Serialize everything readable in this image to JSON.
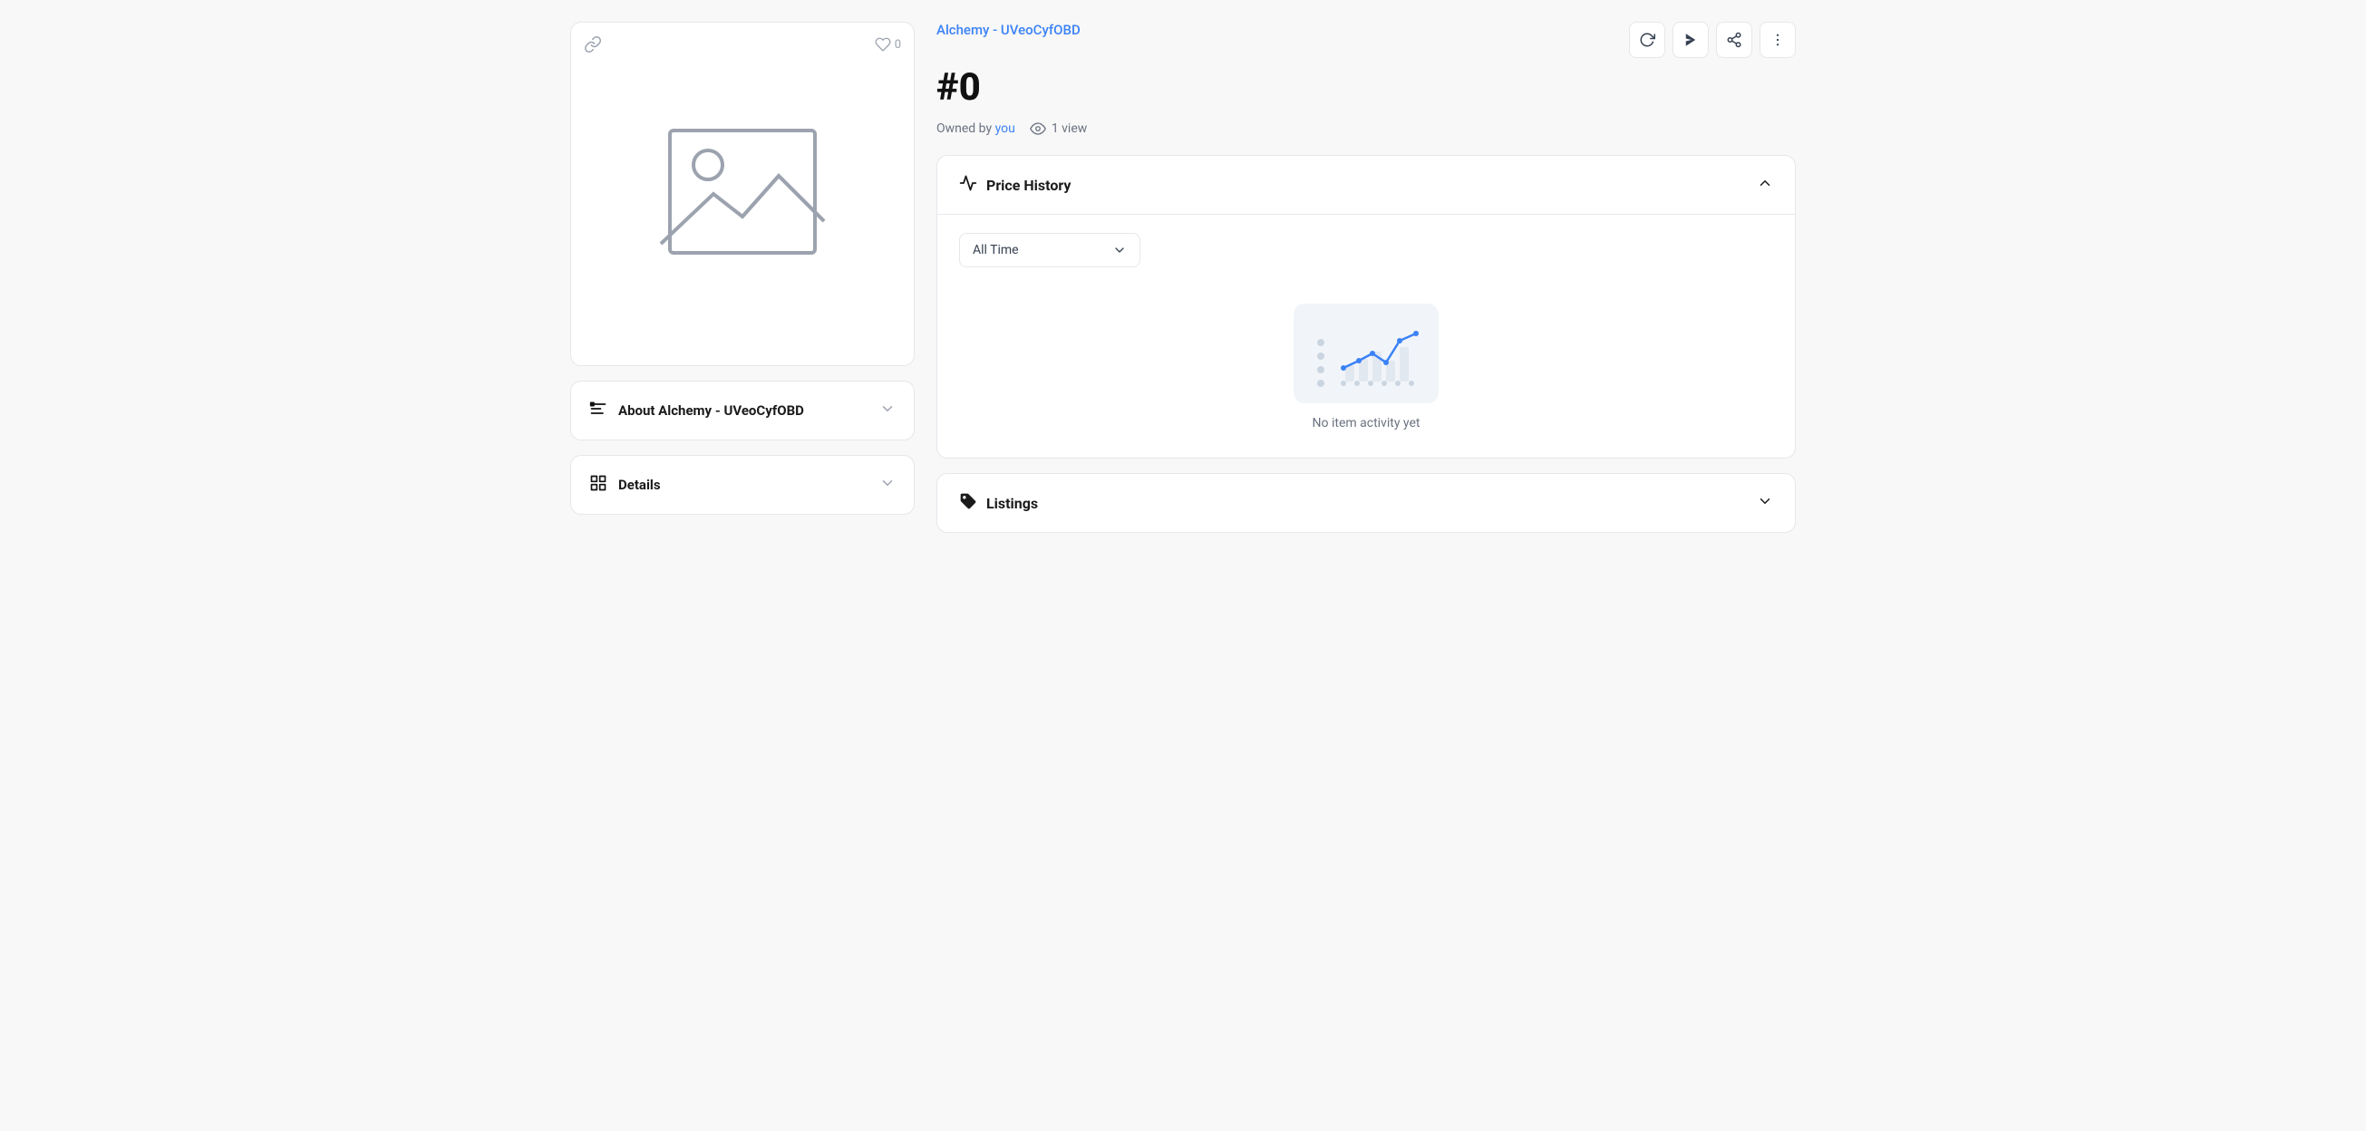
{
  "header": {
    "title": "Alchemy - UVeoCyfOBD",
    "item_number": "#0",
    "owned_by_label": "Owned by",
    "owner": "you",
    "views_count": "1 view"
  },
  "actions": {
    "refresh_label": "refresh",
    "send_label": "send",
    "share_label": "share",
    "more_label": "more options"
  },
  "image_card": {
    "hearts_count": "0"
  },
  "left_sections": {
    "about_label": "About Alchemy - UVeoCyfOBD",
    "details_label": "Details"
  },
  "price_history": {
    "section_title": "Price History",
    "time_filter": "All Time",
    "no_activity_text": "No item activity yet"
  },
  "listings": {
    "section_title": "Listings"
  }
}
